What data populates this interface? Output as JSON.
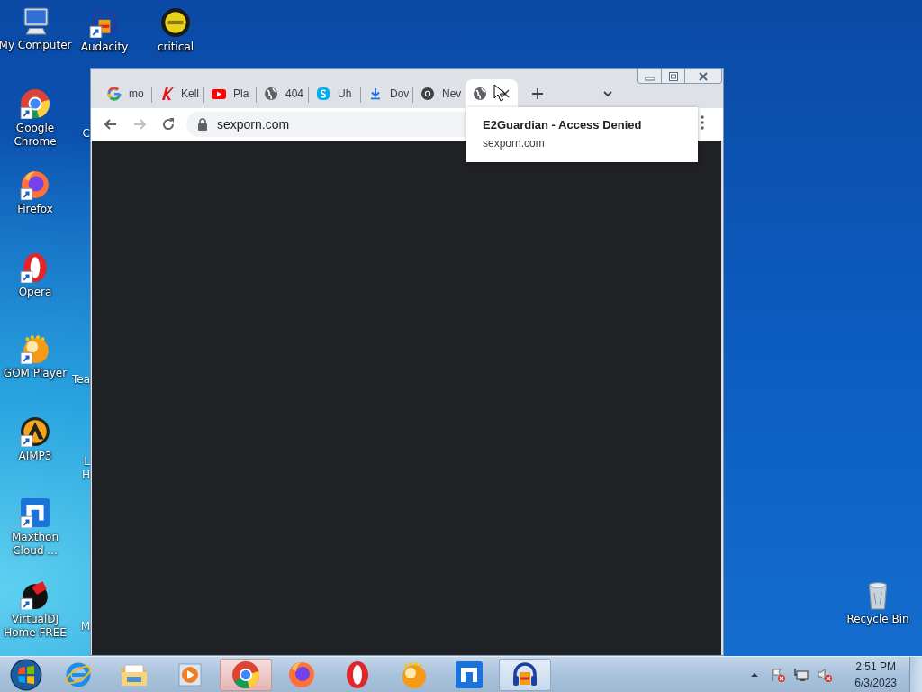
{
  "desktop": {
    "icons": [
      {
        "label": "My Computer"
      },
      {
        "label": "Audacity"
      },
      {
        "label": "critical"
      },
      {
        "label": "Google Chrome"
      },
      {
        "label": "Firefox"
      },
      {
        "label": "Opera"
      },
      {
        "label": "GOM Player"
      },
      {
        "label": "AIMP3"
      },
      {
        "label": "Maxthon Cloud ..."
      },
      {
        "label": "VirtualDJ Home FREE"
      },
      {
        "label": "Recycle Bin"
      }
    ],
    "partly_hidden_labels": [
      "C",
      "Tea",
      "L",
      "H",
      "M"
    ]
  },
  "browser": {
    "tabs": [
      {
        "title": "mo",
        "selected": false
      },
      {
        "title": "Kell",
        "selected": false
      },
      {
        "title": "Pla",
        "selected": false
      },
      {
        "title": "404",
        "selected": false
      },
      {
        "title": "Uh",
        "selected": false
      },
      {
        "title": "Dov",
        "selected": false
      },
      {
        "title": "Nev",
        "selected": false
      },
      {
        "selected": true
      }
    ],
    "navigation": {
      "back_disabled": false,
      "forward_disabled": true
    },
    "address_bar": {
      "url": "sexporn.com"
    },
    "hover_card": {
      "title": "E2Guardian - Access Denied",
      "url": "sexporn.com"
    }
  },
  "taskbar": {
    "apps": [
      {
        "active": false,
        "running": false
      },
      {
        "active": false,
        "running": false
      },
      {
        "active": false,
        "running": false
      },
      {
        "active": true,
        "running": true
      },
      {
        "active": false,
        "running": false
      },
      {
        "active": false,
        "running": false
      },
      {
        "active": false,
        "running": false
      },
      {
        "active": false,
        "running": false
      },
      {
        "active": false,
        "running": true
      }
    ],
    "clock": {
      "time": "2:51 PM",
      "date": "6/3/2023"
    }
  }
}
